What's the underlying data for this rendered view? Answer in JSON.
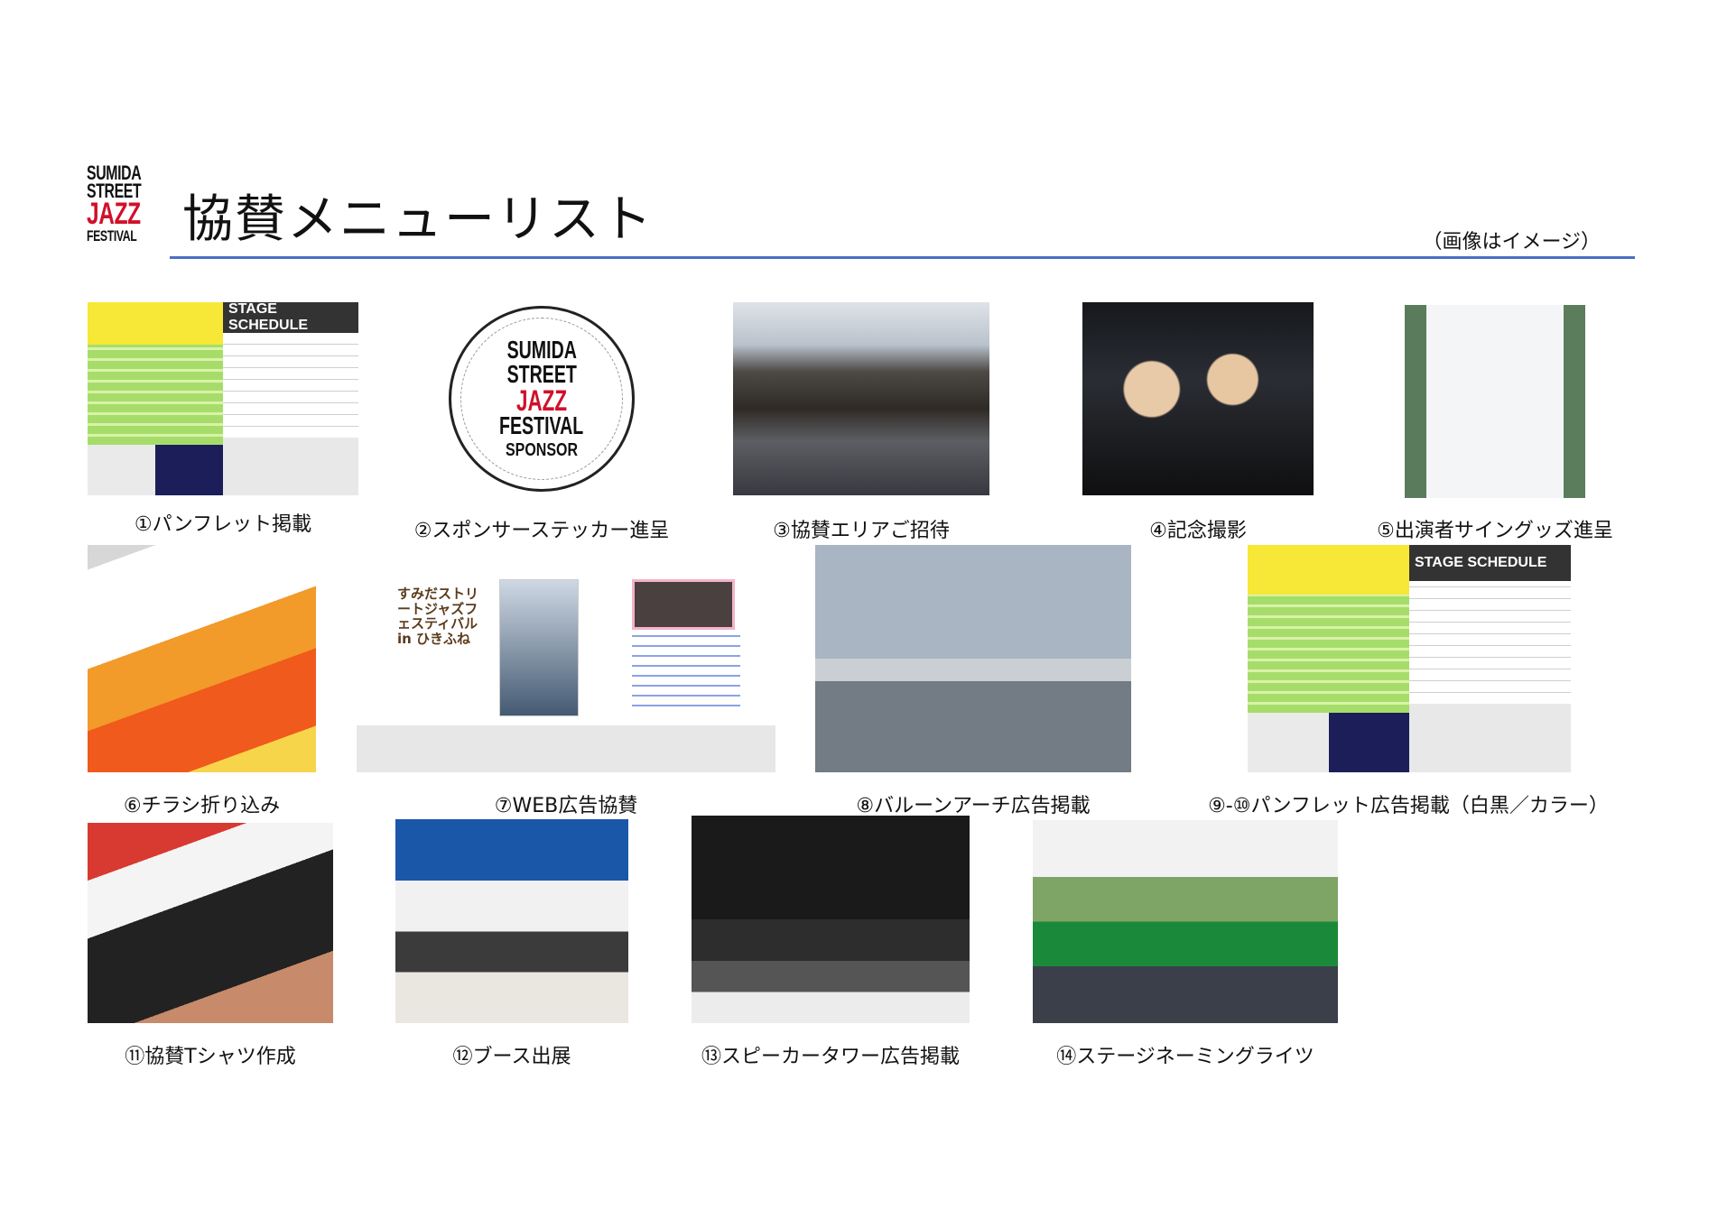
{
  "header": {
    "logo_lines": [
      "SUMIDA",
      "STREET",
      "JAZZ",
      "FESTIVAL"
    ],
    "title": "協賛メニューリスト",
    "note": "（画像はイメージ）"
  },
  "sticker": {
    "lines": [
      "SUMIDA",
      "STREET",
      "JAZZ",
      "FESTIVAL",
      "SPONSOR"
    ]
  },
  "pamphlet": {
    "schedule_heading": "STAGE SCHEDULE"
  },
  "items": [
    {
      "caption": "①パンフレット掲載"
    },
    {
      "caption": "②スポンサーステッカー進呈"
    },
    {
      "caption": "③協賛エリアご招待"
    },
    {
      "caption": "④記念撮影"
    },
    {
      "caption": "⑤出演者サイングッズ進呈"
    },
    {
      "caption": "⑥チラシ折り込み"
    },
    {
      "caption": "⑦WEB広告協賛"
    },
    {
      "caption": "⑧バルーンアーチ広告掲載"
    },
    {
      "caption": "⑨-⑩パンフレット広告掲載（白黒／カラー）"
    },
    {
      "caption": "⑪協賛Tシャツ作成"
    },
    {
      "caption": "⑫ブース出展"
    },
    {
      "caption": "⑬スピーカータワー広告掲載"
    },
    {
      "caption": "⑭ステージネーミングライツ"
    }
  ],
  "web_ad": {
    "logo_text": "すみだストリートジャズフェスティバル in ひきふね"
  },
  "colors": {
    "accent_rule": "#4a6fc4",
    "logo_red": "#d0102a"
  }
}
